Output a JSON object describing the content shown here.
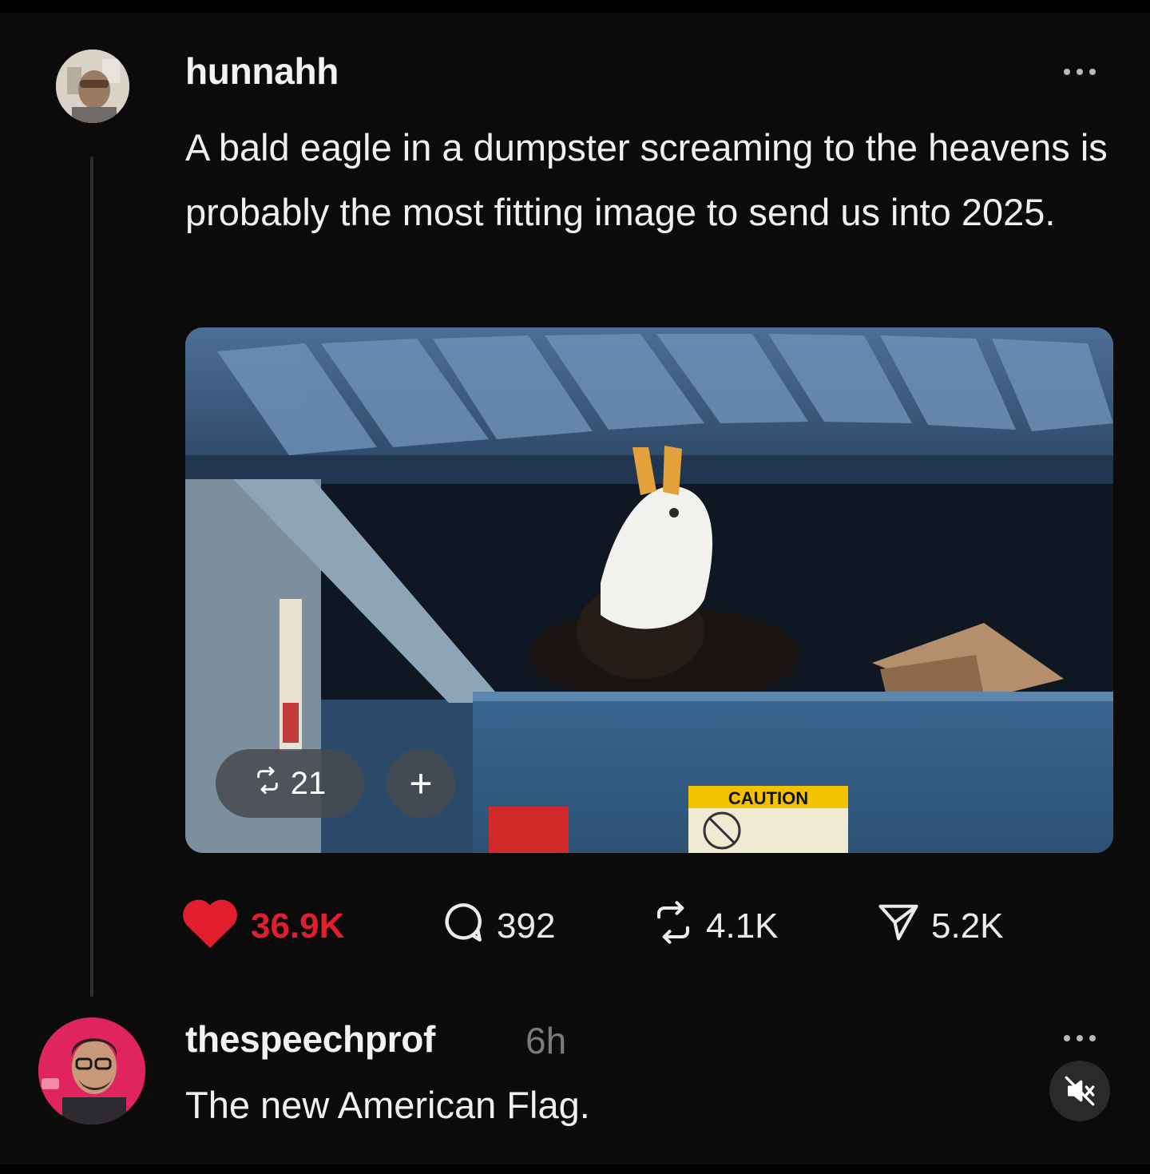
{
  "post": {
    "username": "hunnahh",
    "text": "A bald eagle in a dumpster screaming to the heavens is probably the most fitting image to send us into 2025.",
    "media": {
      "repost_count": "21",
      "plus_label": "+",
      "sign_text": "CAUTION"
    },
    "stats": {
      "likes": "36.9K",
      "comments": "392",
      "reposts": "4.1K",
      "shares": "5.2K"
    }
  },
  "reply": {
    "username": "thespeechprof",
    "time_ago": "6h",
    "text": "The new American Flag."
  },
  "colors": {
    "background": "#0b0b0c",
    "like_red": "#e01e2e",
    "muted_text": "#7b7b7f"
  },
  "icons": [
    "more-icon",
    "repost-icon",
    "plus-icon",
    "heart-icon",
    "comment-icon",
    "share-icon",
    "mute-icon"
  ]
}
